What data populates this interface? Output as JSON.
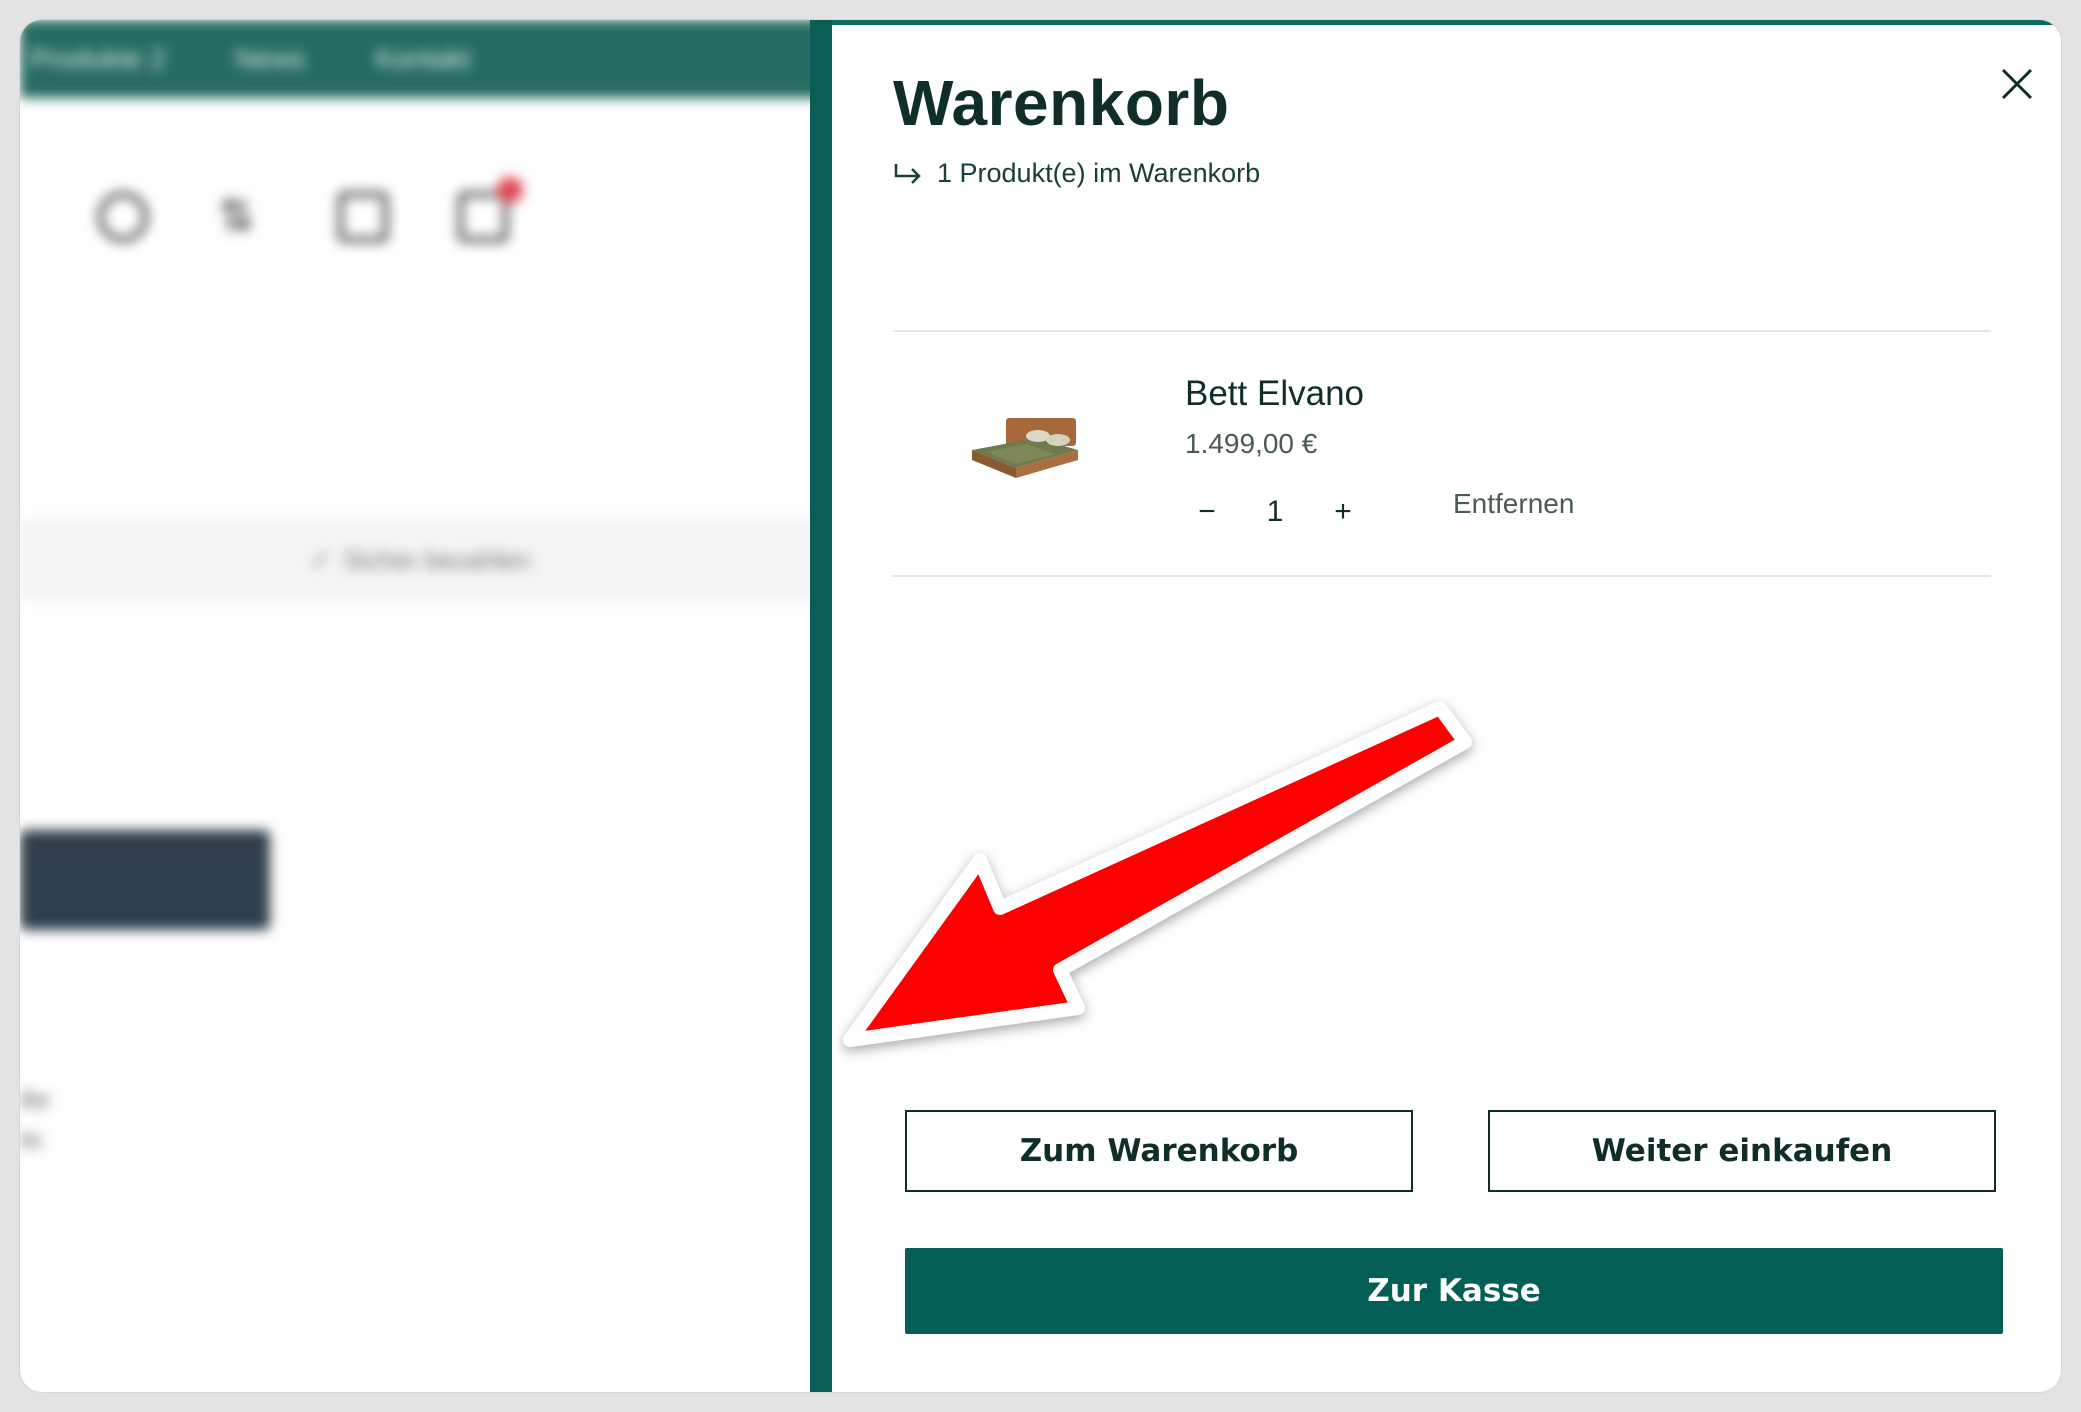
{
  "background": {
    "nav_items": [
      "Produkte 2",
      "News",
      "Kontakt"
    ],
    "secure_payment_text": "Sicher bezahlen",
    "side_text": [
      "Ihr",
      "In"
    ]
  },
  "cart": {
    "title": "Warenkorb",
    "subtitle": "1 Produkt(e) im Warenkorb",
    "item": {
      "name": "Bett Elvano",
      "price": "1.499,00 €",
      "quantity": "1",
      "decrement": "−",
      "increment": "+",
      "remove_label": "Entfernen"
    },
    "buttons": {
      "view_cart": "Zum Warenkorb",
      "continue_shopping": "Weiter einkaufen",
      "checkout": "Zur Kasse"
    }
  },
  "colors": {
    "accent": "#035e55",
    "annotation_arrow": "#ff0000"
  }
}
